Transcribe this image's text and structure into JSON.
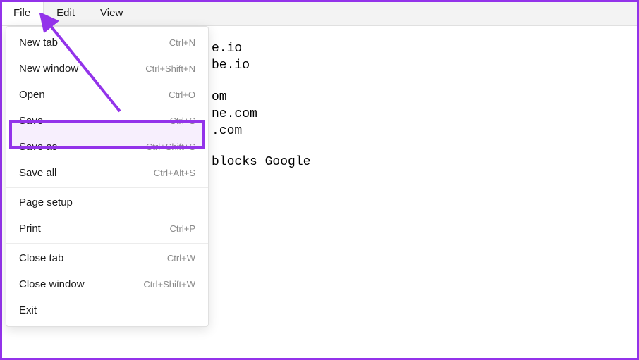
{
  "menubar": {
    "items": [
      {
        "label": "File",
        "active": true
      },
      {
        "label": "Edit",
        "active": false
      },
      {
        "label": "View",
        "active": false
      }
    ]
  },
  "dropdown": {
    "sections": [
      [
        {
          "label": "New tab",
          "shortcut": "Ctrl+N"
        },
        {
          "label": "New window",
          "shortcut": "Ctrl+Shift+N"
        },
        {
          "label": "Open",
          "shortcut": "Ctrl+O"
        },
        {
          "label": "Save",
          "shortcut": "Ctrl+S"
        },
        {
          "label": "Save as",
          "shortcut": "Ctrl+Shift+S"
        },
        {
          "label": "Save all",
          "shortcut": "Ctrl+Alt+S"
        }
      ],
      [
        {
          "label": "Page setup",
          "shortcut": ""
        },
        {
          "label": "Print",
          "shortcut": "Ctrl+P"
        }
      ],
      [
        {
          "label": "Close tab",
          "shortcut": "Ctrl+W"
        },
        {
          "label": "Close window",
          "shortcut": "Ctrl+Shift+W"
        },
        {
          "label": "Exit",
          "shortcut": ""
        }
      ]
    ]
  },
  "content": {
    "block1": [
      "e.io",
      "be.io"
    ],
    "block2": [
      "om",
      "ne.com",
      ".com"
    ],
    "block3": [
      "blocks Google"
    ]
  }
}
